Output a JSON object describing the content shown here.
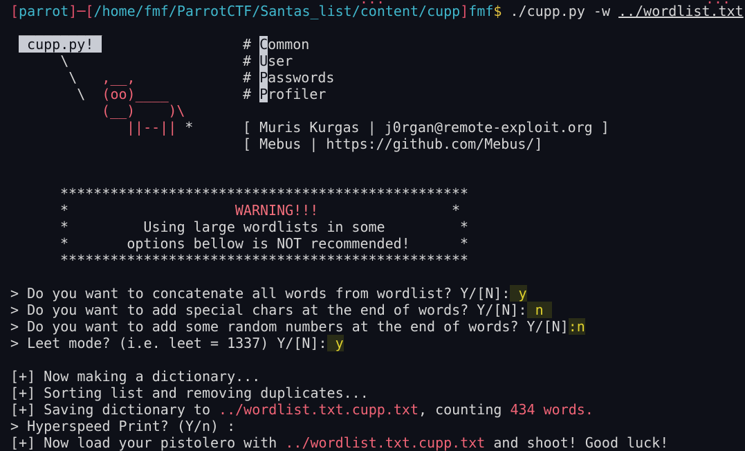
{
  "terminal": {
    "top_fragment_a": "...",
    "top_fragment_b": "...",
    "prompt": {
      "open_bracket": "[",
      "user": "parrot",
      "separator": "]─[",
      "path": "/home/fmf/ParrotCTF/Santas_list/content/cupp",
      "close_bracket": "]",
      "host": "fmf",
      "dollar": "$",
      "command": " ./cupp.py -w ",
      "argument": "../wordlist.txt"
    },
    "logo": {
      "banner_bar": "__________",
      "banner_label": " cupp.py! ",
      "line3": "     \\",
      "line4a": "      \\   ",
      "line4b": ",__,",
      "line5a": "       \\  ",
      "line5b": "(oo)____",
      "line6": "(__)    )\\",
      "line7a": "||--||",
      "line7b": " *"
    },
    "acronym": [
      {
        "hash": "# ",
        "first": "C",
        "rest": "ommon"
      },
      {
        "hash": "# ",
        "first": "U",
        "rest": "ser"
      },
      {
        "hash": "# ",
        "first": "P",
        "rest": "asswords"
      },
      {
        "hash": "# ",
        "first": "P",
        "rest": "rofiler"
      }
    ],
    "credits": [
      "[ Muris Kurgas | j0rgan@remote-exploit.org ]",
      "[ Mebus | https://github.com/Mebus/]"
    ],
    "warning_box": {
      "border": "*************************************************",
      "line1_pre": "*                    ",
      "line1_title": "WARNING!!!",
      "line1_post": "                *",
      "line2": "*         Using large wordlists in some         *",
      "line3": "*       options bellow is NOT recommended!      *"
    },
    "questions": [
      {
        "text": "> Do you want to concatenate all words from wordlist? Y/[N]:",
        "answer": " y"
      },
      {
        "text": "> Do you want to add special chars at the end of words? Y/[N]:",
        "answer": " n "
      },
      {
        "text": "> Do you want to add some random numbers at the end of words? Y/[N]",
        "answer": ":n"
      },
      {
        "text": "> Leet mode? (i.e. leet = 1337) Y/[N]:",
        "answer": " y"
      }
    ],
    "output": {
      "making": "[+] Now making a dictionary...",
      "sorting": "[+] Sorting list and removing duplicates...",
      "saving_pre": "[+] Saving dictionary to ",
      "saving_file": "../wordlist.txt.cupp.txt",
      "saving_mid": ", counting ",
      "saving_count": "434 words.",
      "hyperspeed": "> Hyperspeed Print? (Y/n) :",
      "load_pre": "[+] Now load your pistolero with ",
      "load_file": "../wordlist.txt.cupp.txt",
      "load_post": " and shoot! Good luck!"
    }
  },
  "colors": {
    "background": "#0e1018",
    "text": "#d6d6d6",
    "prompt_red": "#e0506a",
    "prompt_cyan": "#40b7cc",
    "dollar_yellow": "#e3c23f",
    "highlight_red": "#f06476",
    "answer_yellow": "#e0d22e",
    "answer_bg": "#2a2d17",
    "cursor_block": "#c9ccd4"
  }
}
